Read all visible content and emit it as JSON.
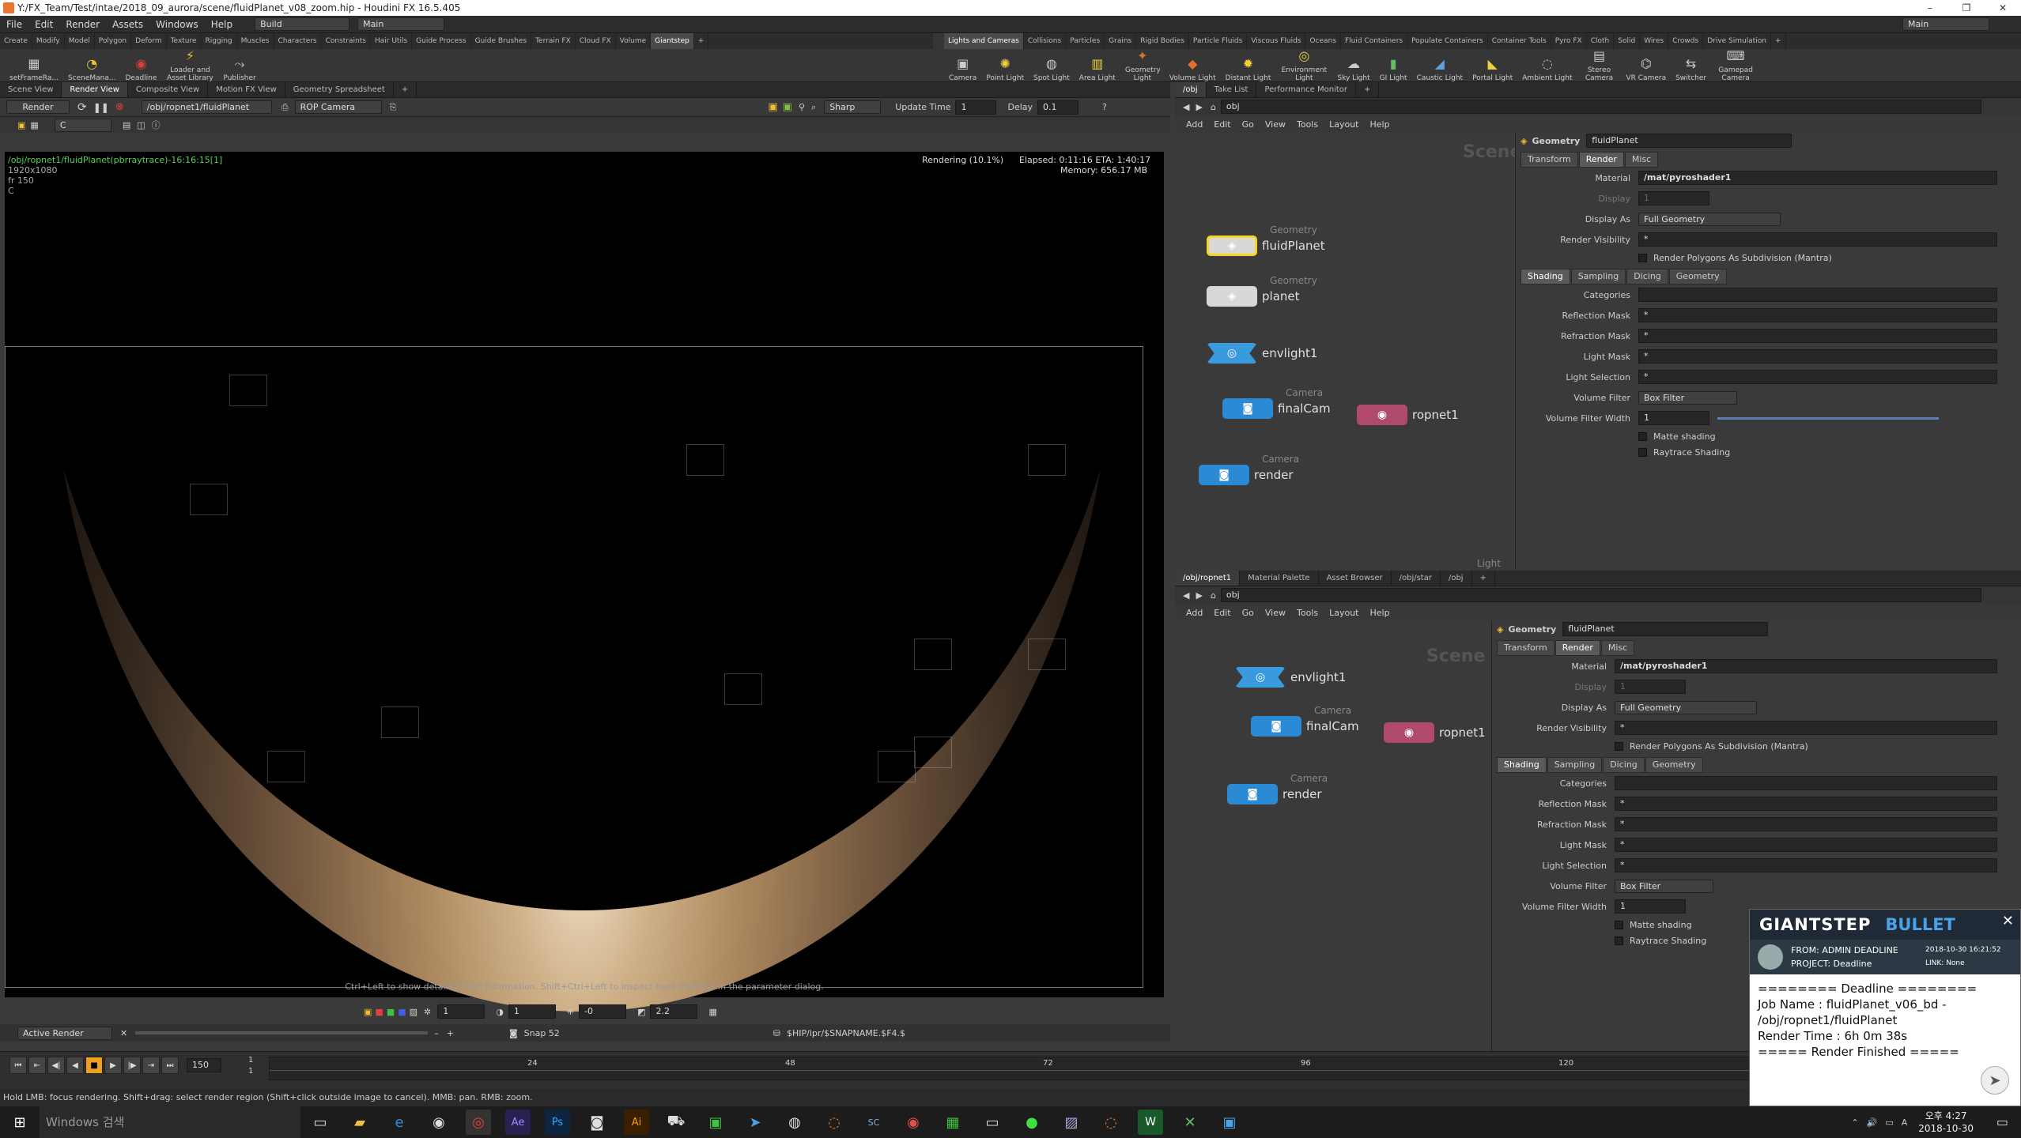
{
  "window": {
    "title": "Y:/FX_Team/Test/intae/2018_09_aurora/scene/fluidPlanet_v08_zoom.hip - Houdini FX 16.5.405"
  },
  "menu": {
    "items": [
      "File",
      "Edit",
      "Render",
      "Assets",
      "Windows",
      "Help"
    ],
    "build": "Build",
    "desktop": "Main",
    "desktop_right": "Main"
  },
  "shelf_left": {
    "tabs": [
      "Create",
      "Modify",
      "Model",
      "Polygon",
      "Deform",
      "Texture",
      "Rigging",
      "Muscles",
      "Characters",
      "Constraints",
      "Hair Utils",
      "Guide Process",
      "Guide Brushes",
      "Terrain FX",
      "Cloud FX",
      "Volume",
      "Giantstep"
    ],
    "tools": [
      "setFrameRa...",
      "SceneMana...",
      "Deadline",
      "Loader and Asset Library",
      "Publisher"
    ]
  },
  "shelf_right": {
    "tabs": [
      "Lights and Cameras",
      "Collisions",
      "Particles",
      "Grains",
      "Rigid Bodies",
      "Particle Fluids",
      "Viscous Fluids",
      "Oceans",
      "Fluid Containers",
      "Populate Containers",
      "Container Tools",
      "Pyro FX",
      "Cloth",
      "Solid",
      "Wires",
      "Crowds",
      "Drive Simulation"
    ],
    "tools": [
      "Camera",
      "Point Light",
      "Spot Light",
      "Area Light",
      "Geometry Light",
      "Volume Light",
      "Distant Light",
      "Environment Light",
      "Sky Light",
      "GI Light",
      "Caustic Light",
      "Portal Light",
      "Ambient Light",
      "Stereo Camera",
      "VR Camera",
      "Switcher",
      "Gamepad Camera"
    ]
  },
  "viewer": {
    "tabs": [
      "Scene View",
      "Render View",
      "Composite View",
      "Motion FX View",
      "Geometry Spreadsheet"
    ],
    "render_button": "Render",
    "rop_path": "/obj/ropnet1/fluidPlanet",
    "camera": "ROP Camera",
    "quality": "Sharp",
    "update_time_label": "Update Time",
    "update_time": "1",
    "delay_label": "Delay",
    "delay": "0.1",
    "channel": "C",
    "info_path": "/obj/ropnet1/fluidPlanet(pbrraytrace)-16:16:15[1]",
    "info_res": "1920x1080",
    "info_frame": "fr 150",
    "info_c": "C",
    "rendering": "Rendering (10.1%)",
    "elapsed": "Elapsed: 0:11:16   ETA: 1:40:17",
    "memory": "Memory:   656.17 MB",
    "hint": "Ctrl+Left to show detailed pixel information. Shift+Ctrl+Left to inspect base material in the parameter dialog.",
    "bottom_vals": [
      "1",
      "1",
      "-0",
      "2.2"
    ],
    "active_render": "Active Render",
    "snap": "Snap 52",
    "snap_path": "$HIP/ipr/$SNAPNAME.$F4.$"
  },
  "net1": {
    "tabs": [
      "/obj",
      "Take List",
      "Performance Monitor"
    ],
    "path": "obj",
    "menu": [
      "Add",
      "Edit",
      "Go",
      "View",
      "Tools",
      "Layout",
      "Help"
    ],
    "scene_label": "Scene",
    "nodes": [
      {
        "type": "Geometry",
        "name": "fluidPlanet"
      },
      {
        "type": "Geometry",
        "name": "planet"
      },
      {
        "type": "",
        "name": "envlight1"
      },
      {
        "type": "Camera",
        "name": "finalCam"
      },
      {
        "type": "",
        "name": "ropnet1"
      },
      {
        "type": "Camera",
        "name": "render"
      }
    ],
    "partial_label": "Light"
  },
  "params": {
    "header_type": "Geometry",
    "header_name": "fluidPlanet",
    "tabs": [
      "Transform",
      "Render",
      "Misc"
    ],
    "material_label": "Material",
    "material": "/mat/pyroshader1",
    "display_label": "Display",
    "display_val": "1",
    "display_as_label": "Display As",
    "display_as": "Full Geometry",
    "render_vis_label": "Render Visibility",
    "render_vis": "*",
    "subdiv_label": "Render Polygons As Subdivision (Mantra)",
    "subtabs": [
      "Shading",
      "Sampling",
      "Dicing",
      "Geometry"
    ],
    "categories_label": "Categories",
    "reflection_label": "Reflection Mask",
    "reflection": "*",
    "refraction_label": "Refraction Mask",
    "refraction": "*",
    "lightmask_label": "Light Mask",
    "lightmask": "*",
    "lightsel_label": "Light Selection",
    "lightsel": "*",
    "volfilter_label": "Volume Filter",
    "volfilter": "Box Filter",
    "volwidth_label": "Volume Filter Width",
    "volwidth": "1",
    "matte_label": "Matte shading",
    "raytrace_label": "Raytrace Shading"
  },
  "net2": {
    "tabs": [
      "/obj/ropnet1",
      "Material Palette",
      "Asset Browser",
      "/obj/star",
      "/obj"
    ],
    "path": "obj",
    "menu": [
      "Add",
      "Edit",
      "Go",
      "View",
      "Tools",
      "Layout",
      "Help"
    ],
    "scene_label": "Scene",
    "nodes": [
      {
        "type": "",
        "name": "envlight1"
      },
      {
        "type": "Camera",
        "name": "finalCam"
      },
      {
        "type": "",
        "name": "ropnet1"
      },
      {
        "type": "Camera",
        "name": "render"
      }
    ]
  },
  "timeline": {
    "frame": "150",
    "start": "1",
    "start2": "1",
    "ticks": [
      "24",
      "48",
      "72",
      "96",
      "120"
    ]
  },
  "status": "Hold LMB: focus rendering. Shift+drag: select render region (Shift+click outside image to cancel). MMB: pan. RMB: zoom.",
  "taskbar": {
    "search": "Windows 검색",
    "time": "오후 4:27",
    "date": "2018-10-30"
  },
  "notification": {
    "brand1": "GIANTSTEP",
    "brand2": "BULLET",
    "from": "FROM: ADMIN DEADLINE",
    "timestamp": "2018-10-30 16:21:52",
    "project": "PROJECT: Deadline",
    "link": "LINK: None",
    "line1": "======== Deadline ========",
    "line2": "Job Name : fluidPlanet_v06_bd -",
    "line3": "/obj/ropnet1/fluidPlanet",
    "line4": "Render Time : 6h 0m 38s",
    "line5": "===== Render Finished ====="
  },
  "colors": {
    "accent_yellow": "#f5d623",
    "geo_node": "#d8d8d8",
    "cam_node": "#2a8ad4",
    "rop_node": "#b04a6a",
    "light_node": "#3a9ade"
  }
}
